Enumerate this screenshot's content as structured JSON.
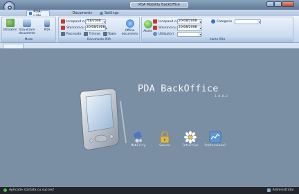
{
  "window": {
    "title": "PDA Mobility BackOffice"
  },
  "tabs": [
    {
      "label": "PDA-urile",
      "icon": "pda-icon"
    },
    {
      "label": "Documents",
      "icon": "document-icon"
    },
    {
      "label": "Settings",
      "icon": "settings-icon"
    }
  ],
  "ribbon": {
    "group_mode": {
      "label": "Mode",
      "buttons": [
        "Utilizatori",
        "Vizualizare documente",
        "PDA"
      ]
    },
    "group_documents": {
      "label": "Documente PDA",
      "incepand_label": "Incepand cu",
      "incepand_value": "/08/2008",
      "sfarsind_label": "Sfarsind cu",
      "sfarsind_value": "20/08/2008",
      "buttons": [
        "Procesate",
        "Trimise",
        "Toate"
      ],
      "offline_label": "Offline documents"
    },
    "group_alerts": {
      "label": "Alerte PDA",
      "button": "Alerte",
      "incepand_label": "Incepand cu",
      "incepand_value": "20/08/2008",
      "sfarsind_label": "Sfarsind cu",
      "sfarsind_value": "20/08/2008",
      "utilizatori_label": "Utilizatori",
      "utilizatori_value": "",
      "categorie_label": "Categorie",
      "categorie_value": ""
    }
  },
  "splash": {
    "title": "PDA BackOffice",
    "version": "1.0.0.2",
    "features": [
      "Mobility",
      "Secure",
      "Intuitive",
      "Professional"
    ]
  },
  "status": {
    "left": "Aplicatie startata cu succes!",
    "user": "Administrator"
  },
  "colors": {
    "accent": "#2d5aa8",
    "workspace": "#7a8ea4",
    "statusbar": "#22262c"
  }
}
